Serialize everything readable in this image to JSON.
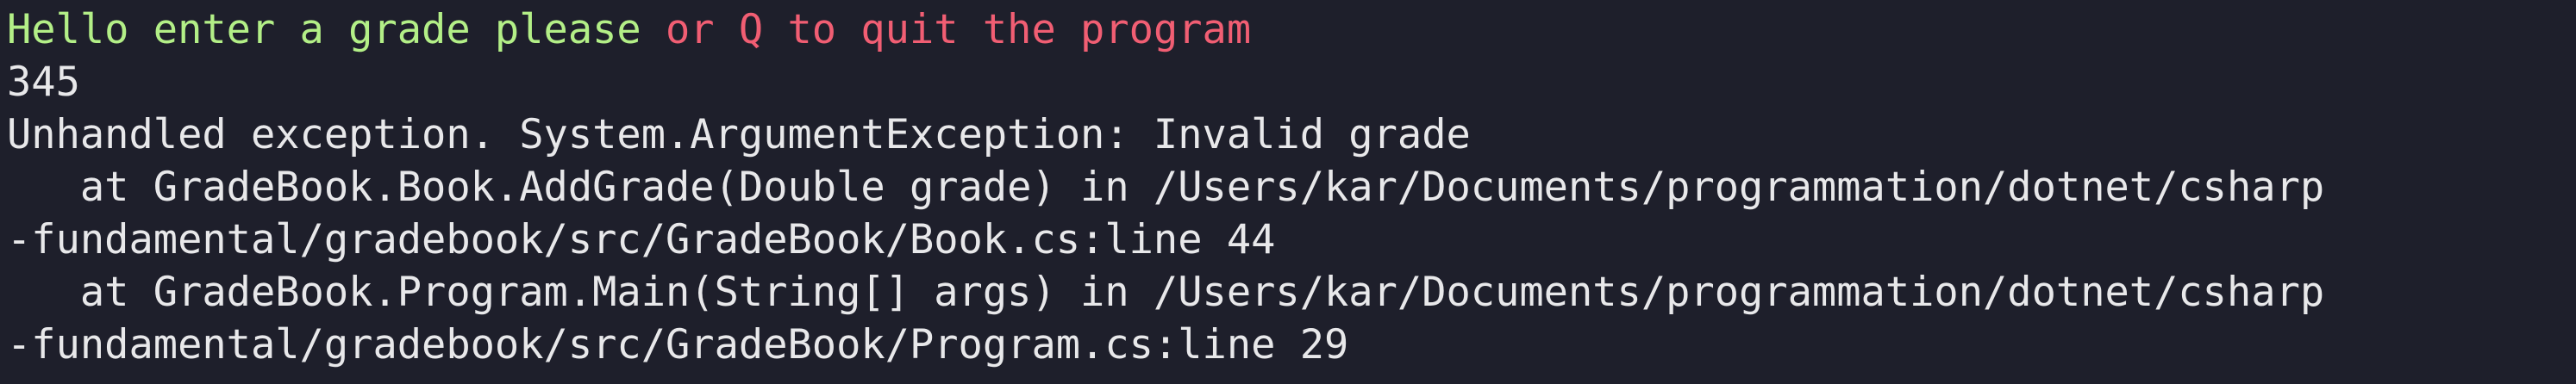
{
  "terminal": {
    "prompt_part1": "Hello enter a grade please ",
    "prompt_part2": "or Q to quit the program",
    "input_value": "345",
    "exception": "Unhandled exception. System.ArgumentException: Invalid grade",
    "stack1_a": "   at GradeBook.Book.AddGrade(Double grade) in /Users/kar/Documents/programmation/dotnet/csharp",
    "stack1_b": "-fundamental/gradebook/src/GradeBook/Book.cs:line 44",
    "stack2_a": "   at GradeBook.Program.Main(String[] args) in /Users/kar/Documents/programmation/dotnet/csharp",
    "stack2_b": "-fundamental/gradebook/src/GradeBook/Program.cs:line 29"
  },
  "colors": {
    "background": "#1e1f2b",
    "text": "#e8e8ea",
    "prompt_green": "#b3ef87",
    "prompt_red": "#f15e73"
  }
}
